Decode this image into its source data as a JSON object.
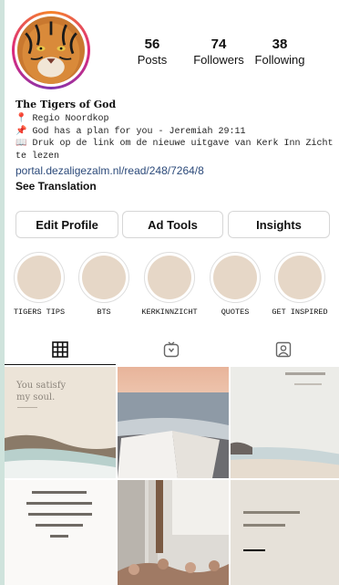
{
  "profile": {
    "name": "The Tigers of God",
    "bio_lines": [
      "📍 Regio Noordkop",
      "📌 God has a plan for you - Jeremiah 29:11",
      "📖 Druk op de link om de nieuwe uitgave van Kerk Inn Zicht",
      "te lezen"
    ],
    "link": "portal.dezaligezalm.nl/read/248/7264/8",
    "see_translation": "See Translation"
  },
  "stats": {
    "posts": {
      "value": "56",
      "label": "Posts"
    },
    "followers": {
      "value": "74",
      "label": "Followers"
    },
    "following": {
      "value": "38",
      "label": "Following"
    }
  },
  "buttons": {
    "edit_profile": "Edit Profile",
    "ad_tools": "Ad Tools",
    "insights": "Insights"
  },
  "highlights": [
    {
      "label": "TIGERS TIPS"
    },
    {
      "label": "BTS"
    },
    {
      "label": "KERKINNZICHT"
    },
    {
      "label": "QUOTES"
    },
    {
      "label": "GET INSPIRED"
    }
  ],
  "tabs": [
    {
      "icon": "grid-icon"
    },
    {
      "icon": "igtv-icon"
    },
    {
      "icon": "tagged-icon"
    }
  ],
  "grid": {
    "post1_text": "You satisfy\nmy soul."
  },
  "colors": {
    "link": "#2c4a7a",
    "highlight_fill": "#e6d7c7",
    "background": "#cfe3dc"
  }
}
